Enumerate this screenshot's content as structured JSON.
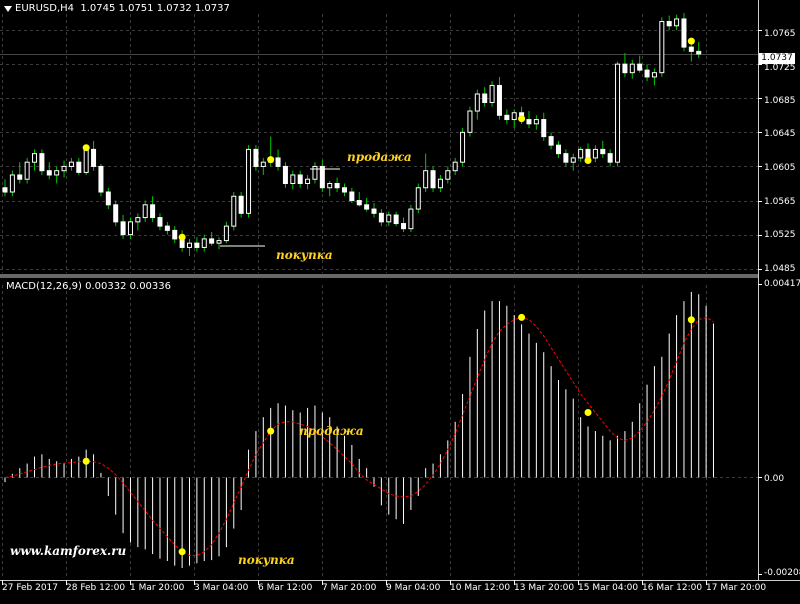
{
  "header": {
    "symbol": "EURUSD,H4",
    "ohlc": "1.0745 1.0751 1.0732 1.0737"
  },
  "macd": {
    "label": "MACD(12,26,9) 0.00332 0.00336"
  },
  "current_price": "1.0737",
  "watermark": "www.kamforex.ru",
  "annotations": {
    "sell": "продажа",
    "buy": "покупка"
  },
  "colors": {
    "background": "#000000",
    "grid": "#3c3c3c",
    "bull_candle": "#ffffff",
    "bear_candle": "#ffffff",
    "wick": "#00c800",
    "macd_histogram": "#ffffff",
    "signal_line": "#ff0000",
    "marker": "#ffff00",
    "annotation": "#ffd21f"
  },
  "chart_data": [
    {
      "type": "candlestick",
      "title": "EURUSD,H4",
      "y_ticks": [
        "1.0765",
        "1.0725",
        "1.0685",
        "1.0645",
        "1.0605",
        "1.0565",
        "1.0525",
        "1.0485"
      ],
      "ylim": [
        1.048,
        1.0785
      ],
      "x_ticks": [
        "27 Feb 2017",
        "28 Feb 12:00",
        "1 Mar 20:00",
        "3 Mar 04:00",
        "6 Mar 12:00",
        "7 Mar 20:00",
        "9 Mar 04:00",
        "10 Mar 12:00",
        "13 Mar 20:00",
        "15 Mar 04:00",
        "16 Mar 12:00",
        "17 Mar 20:00"
      ],
      "last_close": 1.0737,
      "grid": true,
      "candles": [
        [
          1.058,
          1.059,
          1.057,
          1.0575
        ],
        [
          1.0575,
          1.06,
          1.057,
          1.0595
        ],
        [
          1.0595,
          1.061,
          1.0585,
          1.059
        ],
        [
          1.059,
          1.0615,
          1.0585,
          1.061
        ],
        [
          1.061,
          1.0625,
          1.06,
          1.062
        ],
        [
          1.062,
          1.0625,
          1.0595,
          1.06
        ],
        [
          1.06,
          1.061,
          1.059,
          1.0595
        ],
        [
          1.0595,
          1.0605,
          1.0585,
          1.06
        ],
        [
          1.06,
          1.0612,
          1.0592,
          1.0605
        ],
        [
          1.0605,
          1.0615,
          1.06,
          1.061
        ],
        [
          1.061,
          1.0615,
          1.0595,
          1.0598
        ],
        [
          1.0598,
          1.063,
          1.0595,
          1.0625
        ],
        [
          1.0625,
          1.0635,
          1.06,
          1.0605
        ],
        [
          1.0605,
          1.0608,
          1.057,
          1.0575
        ],
        [
          1.0575,
          1.058,
          1.0555,
          1.056
        ],
        [
          1.056,
          1.0565,
          1.0535,
          1.054
        ],
        [
          1.054,
          1.0548,
          1.052,
          1.0525
        ],
        [
          1.0525,
          1.0545,
          1.052,
          1.054
        ],
        [
          1.054,
          1.055,
          1.053,
          1.0545
        ],
        [
          1.0545,
          1.0565,
          1.054,
          1.056
        ],
        [
          1.056,
          1.057,
          1.054,
          1.0545
        ],
        [
          1.0545,
          1.055,
          1.053,
          1.0535
        ],
        [
          1.0535,
          1.054,
          1.0525,
          1.053
        ],
        [
          1.053,
          1.0535,
          1.0515,
          1.052
        ],
        [
          1.052,
          1.053,
          1.0505,
          1.051
        ],
        [
          1.051,
          1.052,
          1.05,
          1.0515
        ],
        [
          1.0515,
          1.0522,
          1.0505,
          1.051
        ],
        [
          1.051,
          1.0525,
          1.0505,
          1.052
        ],
        [
          1.052,
          1.0528,
          1.0512,
          1.0515
        ],
        [
          1.0515,
          1.0522,
          1.0508,
          1.0518
        ],
        [
          1.0518,
          1.054,
          1.0515,
          1.0535
        ],
        [
          1.0535,
          1.0575,
          1.053,
          1.057
        ],
        [
          1.057,
          1.0575,
          1.0545,
          1.055
        ],
        [
          1.055,
          1.063,
          1.0545,
          1.0625
        ],
        [
          1.0625,
          1.063,
          1.06,
          1.0605
        ],
        [
          1.0605,
          1.0615,
          1.0595,
          1.061
        ],
        [
          1.061,
          1.064,
          1.0605,
          1.0615
        ],
        [
          1.0615,
          1.0625,
          1.06,
          1.0605
        ],
        [
          1.0605,
          1.061,
          1.058,
          1.0585
        ],
        [
          1.0585,
          1.06,
          1.0578,
          1.0595
        ],
        [
          1.0595,
          1.06,
          1.058,
          1.0585
        ],
        [
          1.0585,
          1.0595,
          1.0578,
          1.059
        ],
        [
          1.059,
          1.061,
          1.0585,
          1.0605
        ],
        [
          1.0605,
          1.0612,
          1.0575,
          1.058
        ],
        [
          1.058,
          1.0588,
          1.057,
          1.0585
        ],
        [
          1.0585,
          1.0592,
          1.0575,
          1.058
        ],
        [
          1.058,
          1.0585,
          1.057,
          1.0575
        ],
        [
          1.0575,
          1.058,
          1.0562,
          1.0565
        ],
        [
          1.0565,
          1.0575,
          1.0558,
          1.056
        ],
        [
          1.056,
          1.0568,
          1.0552,
          1.0555
        ],
        [
          1.0555,
          1.0562,
          1.0545,
          1.055
        ],
        [
          1.055,
          1.0555,
          1.0535,
          1.054
        ],
        [
          1.054,
          1.0552,
          1.0535,
          1.0548
        ],
        [
          1.0548,
          1.0552,
          1.0535,
          1.0538
        ],
        [
          1.0538,
          1.0545,
          1.0528,
          1.0532
        ],
        [
          1.0532,
          1.056,
          1.0528,
          1.0555
        ],
        [
          1.0555,
          1.0585,
          1.055,
          1.058
        ],
        [
          1.058,
          1.062,
          1.0575,
          1.06
        ],
        [
          1.06,
          1.0605,
          1.0575,
          1.058
        ],
        [
          1.058,
          1.0595,
          1.0575,
          1.059
        ],
        [
          1.059,
          1.0605,
          1.0585,
          1.06
        ],
        [
          1.06,
          1.0615,
          1.0595,
          1.061
        ],
        [
          1.061,
          1.065,
          1.0605,
          1.0645
        ],
        [
          1.0645,
          1.0675,
          1.064,
          1.067
        ],
        [
          1.067,
          1.0695,
          1.066,
          1.069
        ],
        [
          1.069,
          1.0698,
          1.0675,
          1.068
        ],
        [
          1.068,
          1.0705,
          1.0675,
          1.07
        ],
        [
          1.07,
          1.071,
          1.066,
          1.0665
        ],
        [
          1.0665,
          1.0672,
          1.0655,
          1.066
        ],
        [
          1.066,
          1.0672,
          1.065,
          1.0668
        ],
        [
          1.0668,
          1.0675,
          1.0655,
          1.066
        ],
        [
          1.066,
          1.067,
          1.065,
          1.0655
        ],
        [
          1.0655,
          1.0665,
          1.0648,
          1.066
        ],
        [
          1.066,
          1.0668,
          1.0635,
          1.064
        ],
        [
          1.064,
          1.0645,
          1.0625,
          1.063
        ],
        [
          1.063,
          1.0635,
          1.0615,
          1.062
        ],
        [
          1.062,
          1.0625,
          1.0605,
          1.061
        ],
        [
          1.061,
          1.062,
          1.06,
          1.0615
        ],
        [
          1.0615,
          1.0628,
          1.061,
          1.0625
        ],
        [
          1.0625,
          1.0632,
          1.0612,
          1.0615
        ],
        [
          1.0615,
          1.063,
          1.061,
          1.0625
        ],
        [
          1.0625,
          1.0635,
          1.0615,
          1.062
        ],
        [
          1.062,
          1.0625,
          1.0605,
          1.061
        ],
        [
          1.061,
          1.0728,
          1.0605,
          1.0725
        ],
        [
          1.0725,
          1.0738,
          1.071,
          1.0715
        ],
        [
          1.0715,
          1.073,
          1.0708,
          1.0725
        ],
        [
          1.0725,
          1.0735,
          1.0715,
          1.0718
        ],
        [
          1.0718,
          1.0725,
          1.0705,
          1.071
        ],
        [
          1.071,
          1.072,
          1.07,
          1.0715
        ],
        [
          1.0715,
          1.078,
          1.071,
          1.0775
        ],
        [
          1.0775,
          1.0782,
          1.0765,
          1.077
        ],
        [
          1.077,
          1.0783,
          1.0765,
          1.0778
        ],
        [
          1.0778,
          1.0785,
          1.074,
          1.0745
        ],
        [
          1.0745,
          1.0752,
          1.0728,
          1.074
        ],
        [
          1.074,
          1.0751,
          1.0732,
          1.0737
        ]
      ],
      "markers": [
        {
          "index": 11,
          "value": 1.0627
        },
        {
          "index": 24,
          "value": 1.0522
        },
        {
          "index": 36,
          "value": 1.0613
        },
        {
          "index": 70,
          "value": 1.0661
        },
        {
          "index": 79,
          "value": 1.0612
        },
        {
          "index": 93,
          "value": 1.0752
        }
      ]
    },
    {
      "type": "bar",
      "title": "MACD(12,26,9) 0.00332 0.00336",
      "y_ticks": [
        "0.00417",
        "0.00",
        "-0.00208"
      ],
      "ylim": [
        -0.00208,
        0.00417
      ],
      "histogram": [
        -0.0001,
        8e-05,
        0.0002,
        0.0003,
        0.00045,
        0.0005,
        0.0004,
        0.00035,
        0.0003,
        0.0004,
        0.00045,
        0.0006,
        0.0005,
        0.0001,
        -0.0004,
        -0.0008,
        -0.0012,
        -0.0014,
        -0.0015,
        -0.00155,
        -0.00165,
        -0.00175,
        -0.0018,
        -0.0019,
        -0.00195,
        -0.0019,
        -0.00185,
        -0.0018,
        -0.00178,
        -0.0017,
        -0.0015,
        -0.0011,
        -0.0007,
        0.0006,
        0.001,
        0.0013,
        0.0015,
        0.0016,
        0.00155,
        0.00145,
        0.0014,
        0.0015,
        0.00155,
        0.0014,
        0.0013,
        0.0011,
        0.0009,
        0.0007,
        0.0004,
        0.0002,
        -0.0002,
        -0.0006,
        -0.0008,
        -0.0009,
        -0.001,
        -0.0007,
        -0.0004,
        0.0002,
        0.0003,
        0.0005,
        0.0008,
        0.0012,
        0.0018,
        0.0026,
        0.0032,
        0.0036,
        0.0038,
        0.0038,
        0.0037,
        0.0035,
        0.0033,
        0.0031,
        0.0029,
        0.0027,
        0.0024,
        0.0021,
        0.0019,
        0.0017,
        0.0013,
        0.0011,
        0.001,
        0.0009,
        0.0008,
        0.0009,
        0.001,
        0.0012,
        0.0016,
        0.002,
        0.0024,
        0.0026,
        0.0031,
        0.0035,
        0.0038,
        0.004,
        0.00395,
        0.0037,
        0.00332
      ],
      "signal": [
        0.0,
        3e-05,
        8e-05,
        0.00012,
        0.00017,
        0.00022,
        0.00026,
        0.00029,
        0.00031,
        0.00032,
        0.00034,
        0.00035,
        0.00034,
        0.0003,
        0.0002,
        6e-05,
        -0.00012,
        -0.00032,
        -0.00052,
        -0.00072,
        -0.00092,
        -0.0011,
        -0.00128,
        -0.00145,
        -0.0016,
        -0.00168,
        -0.00168,
        -0.0016,
        -0.00145,
        -0.0012,
        -0.0009,
        -0.00055,
        -0.0002,
        0.00015,
        0.0005,
        0.00075,
        0.001,
        0.00115,
        0.0012,
        0.0012,
        0.00115,
        0.0011,
        0.001,
        0.00088,
        0.00075,
        0.0006,
        0.00045,
        0.0003,
        0.0001,
        -5e-05,
        -0.00015,
        -0.00025,
        -0.00035,
        -0.0004,
        -0.00042,
        -0.0004,
        -0.0003,
        -0.00015,
        5e-05,
        0.0003,
        0.0006,
        0.00095,
        0.00135,
        0.00175,
        0.00215,
        0.00255,
        0.0029,
        0.00315,
        0.0033,
        0.0034,
        0.00345,
        0.0034,
        0.00325,
        0.00305,
        0.0028,
        0.00255,
        0.0023,
        0.00205,
        0.0018,
        0.0016,
        0.0014,
        0.0012,
        0.001,
        0.00085,
        0.0008,
        0.00085,
        0.001,
        0.0012,
        0.00145,
        0.00175,
        0.0021,
        0.0025,
        0.0029,
        0.0032,
        0.0034,
        0.00345,
        0.00336
      ],
      "markers": [
        {
          "index": 11,
          "value": 0.00035
        },
        {
          "index": 24,
          "value": -0.0016
        },
        {
          "index": 36,
          "value": 0.001
        },
        {
          "index": 70,
          "value": 0.00345
        },
        {
          "index": 79,
          "value": 0.0014
        },
        {
          "index": 93,
          "value": 0.0034
        }
      ]
    }
  ]
}
